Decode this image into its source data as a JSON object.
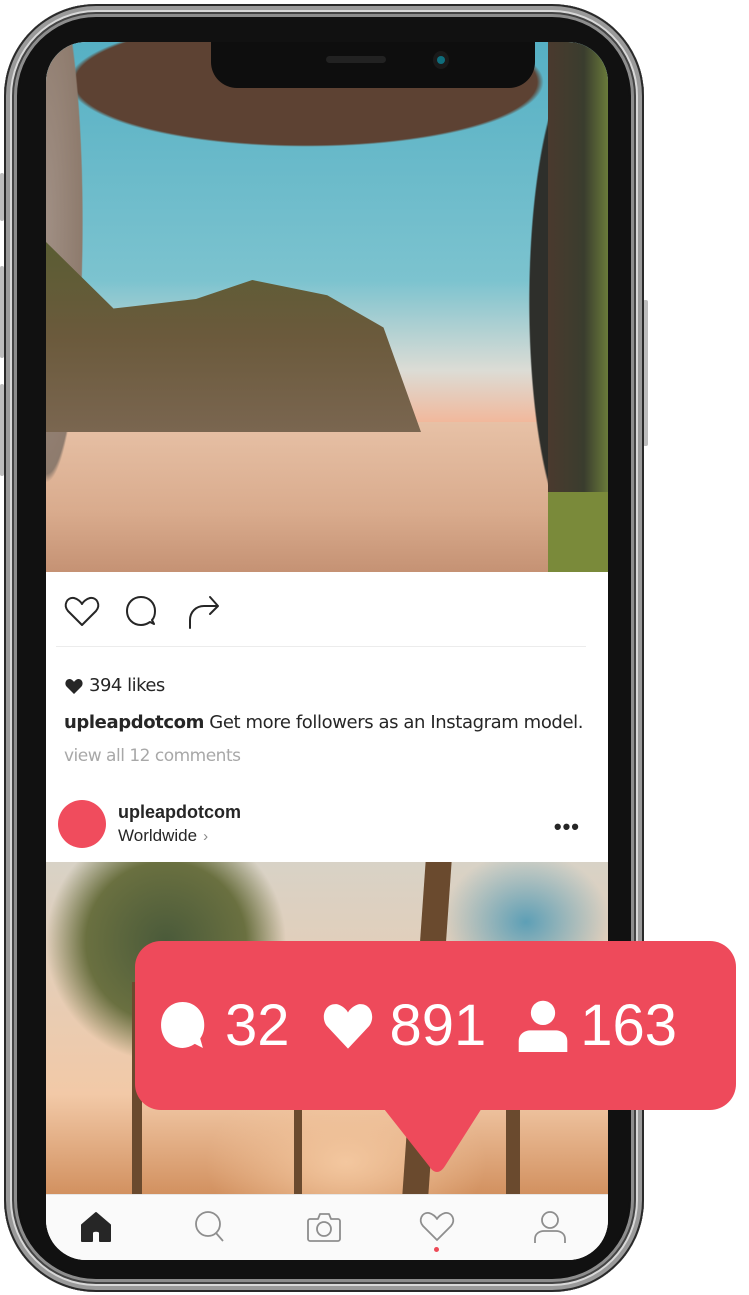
{
  "post1": {
    "actions": {
      "like_icon": "heart-outline-icon",
      "comment_icon": "comment-outline-icon",
      "share_icon": "share-arrow-icon"
    },
    "likes_icon": "heart-filled-icon",
    "likes_text": "394 likes",
    "caption_user": "upleapdotcom",
    "caption_text": " Get more followers as an Instagram model.",
    "view_all_comments": "view all 12 comments"
  },
  "post2": {
    "username": "upleapdotcom",
    "location": "Worldwide",
    "location_chevron": "›",
    "more_label": "•••"
  },
  "notification": {
    "color": "#ee4a5b",
    "comments": "32",
    "likes": "891",
    "followers": "163"
  },
  "tabbar": {
    "items": [
      {
        "name": "home",
        "icon": "home-icon",
        "active": true
      },
      {
        "name": "search",
        "icon": "search-icon",
        "active": false
      },
      {
        "name": "camera",
        "icon": "camera-icon",
        "active": false
      },
      {
        "name": "activity",
        "icon": "heart-icon",
        "active": false,
        "badge_dot": true
      },
      {
        "name": "profile",
        "icon": "profile-icon",
        "active": false
      }
    ],
    "badge_color": "#ed4956"
  }
}
